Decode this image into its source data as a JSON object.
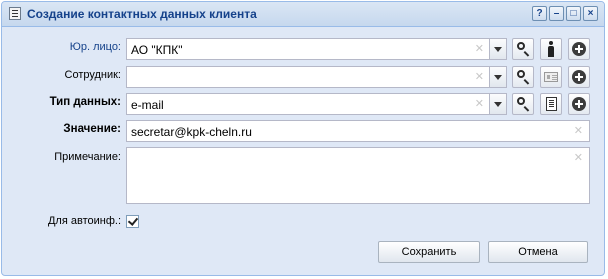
{
  "window": {
    "title": "Создание контактных данных клиента",
    "tools": [
      "?",
      "–",
      "□",
      "×"
    ]
  },
  "form": {
    "legal_entity": {
      "label": "Юр. лицо:",
      "value": "АО \"КПК\""
    },
    "employee": {
      "label": "Сотрудник:",
      "value": ""
    },
    "data_type": {
      "label": "Тип данных:",
      "value": "e-mail"
    },
    "value": {
      "label": "Значение:",
      "value": "secretar@kpk-cheln.ru"
    },
    "note": {
      "label": "Примечание:",
      "value": ""
    },
    "auto_inform": {
      "label": "Для автоинф.:",
      "checked": true
    }
  },
  "buttons": {
    "save": "Сохранить",
    "cancel": "Отмена"
  },
  "icons": {
    "clear": "clear-x-icon",
    "search": "magnifier-icon",
    "add": "plus-circle-icon",
    "person": "person-icon",
    "card": "contact-card-icon",
    "doc": "document-icon"
  }
}
